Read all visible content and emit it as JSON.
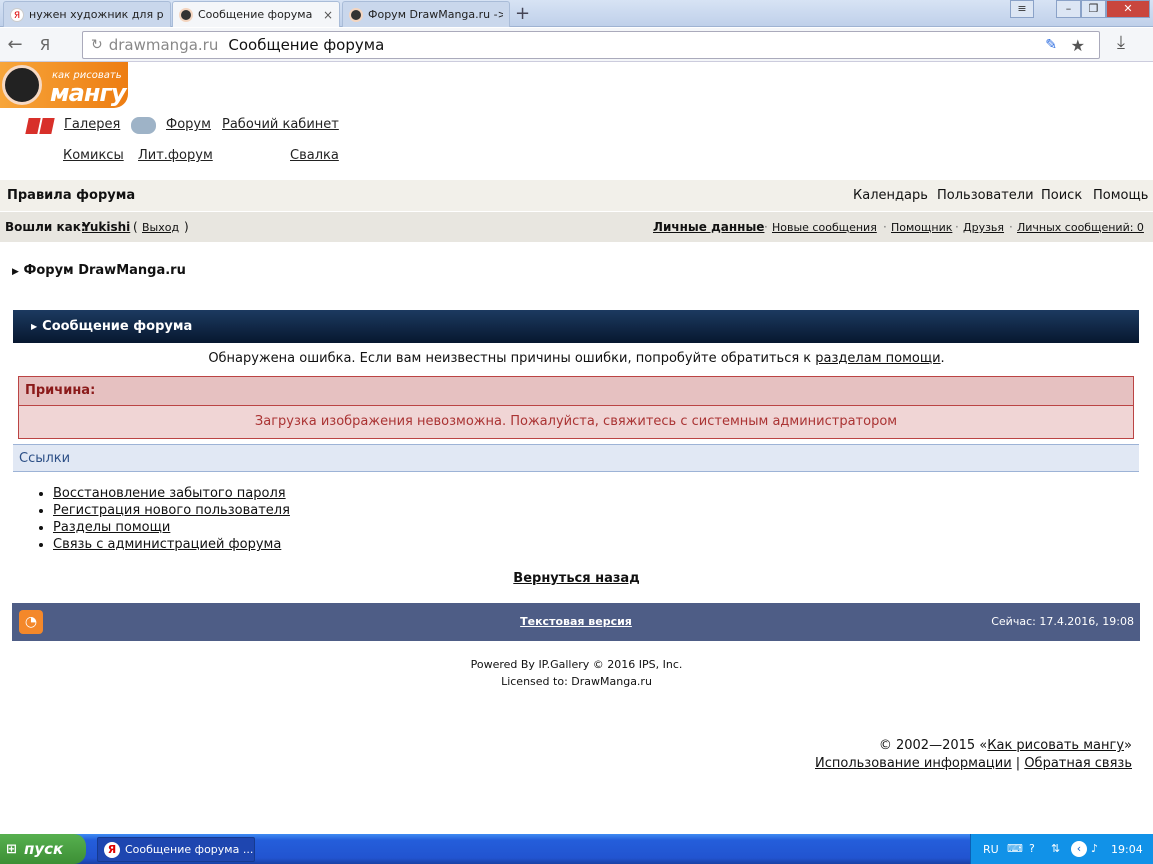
{
  "browser": {
    "tabs": [
      {
        "label": "нужен художник для р",
        "icon": "yandex-icon"
      },
      {
        "label": "Сообщение форума",
        "icon": "manga-icon",
        "close": "×"
      },
      {
        "label": "Форум DrawManga.ru ->",
        "icon": "manga-icon"
      }
    ],
    "new_tab": "+",
    "address_domain": "drawmanga.ru",
    "address_title": "Сообщение форума",
    "yandex_glyph": "Я"
  },
  "site": {
    "logo_small": "как рисовать",
    "logo_big": "мангу",
    "nav_top": [
      "Галерея",
      "Форум",
      "Рабочий кабинет"
    ],
    "nav_bottom": [
      "Комиксы",
      "Лит.форум",
      "Свалка"
    ]
  },
  "bar1": {
    "rules": "Правила форума",
    "links": [
      "Календарь",
      "Пользователи",
      "Поиск",
      "Помощь"
    ]
  },
  "bar2": {
    "logged_prefix": "Вошли как:",
    "user": "Yukishi",
    "logout": "Выход",
    "links": [
      "Личные данные",
      "Новые сообщения",
      "Помощник",
      "Друзья",
      "Личных сообщений: 0"
    ]
  },
  "breadcrumb": "Форум DrawManga.ru",
  "main": {
    "title": "Сообщение форума",
    "error_text": "Обнаружена ошибка. Если вам неизвестны причины ошибки, попробуйте обратиться к",
    "error_link": "разделам помощи",
    "reason_label": "Причина:",
    "reason_msg": "Загрузка изображения невозможна. Пожалуйста, свяжитесь с системным администратором",
    "links_head": "Ссылки",
    "links": [
      "Восстановление забытого пароля",
      "Регистрация нового пользователя",
      "Разделы помощи",
      "Связь с администрацией форума"
    ],
    "back": "Вернуться назад"
  },
  "footer": {
    "text_version": "Текстовая версия",
    "now": "Сейчас: 17.4.2016, 19:08",
    "powered": "Powered By IP.Gallery © 2016  IPS, Inc.",
    "licensed": "Licensed to: DrawManga.ru",
    "copyright_prefix": "© 2002—2015 «",
    "copyright_link": "Как рисовать мангу",
    "copyright_suffix": "»",
    "info_link": "Использование информации",
    "feedback_link": "Обратная связь"
  },
  "taskbar": {
    "start": "пуск",
    "task": "Сообщение форума ...",
    "lang": "RU",
    "time": "19:04"
  },
  "colors": {
    "accent": "#1c3a60",
    "error": "#a33",
    "footer": "#4e5d86"
  }
}
